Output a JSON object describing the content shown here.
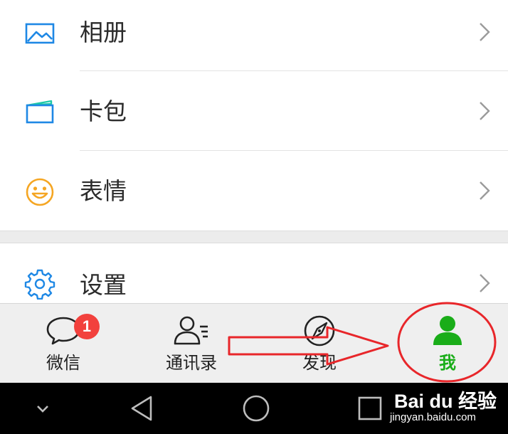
{
  "menu": {
    "items": [
      {
        "label": "相册",
        "icon": "album-icon"
      },
      {
        "label": "卡包",
        "icon": "card-wallet-icon"
      },
      {
        "label": "表情",
        "icon": "smiley-icon"
      },
      {
        "label": "设置",
        "icon": "gear-icon"
      }
    ]
  },
  "tabbar": {
    "tabs": [
      {
        "label": "微信",
        "icon": "chat-bubble-icon",
        "badge": "1"
      },
      {
        "label": "通讯录",
        "icon": "contacts-icon"
      },
      {
        "label": "发现",
        "icon": "compass-icon"
      },
      {
        "label": "我",
        "icon": "person-icon",
        "selected": true
      }
    ]
  },
  "navbar": {
    "buttons": [
      "collapse-icon",
      "back-icon",
      "home-icon",
      "recents-icon"
    ]
  },
  "watermark": {
    "brand": "Bai du 经验",
    "url": "jingyan.baidu.com"
  },
  "colors": {
    "accent_green": "#1aad19",
    "blue_icon": "#1e88e5",
    "orange_icon": "#f5a623",
    "badge_red": "#f2413d",
    "annotation_red": "#e8262a"
  }
}
